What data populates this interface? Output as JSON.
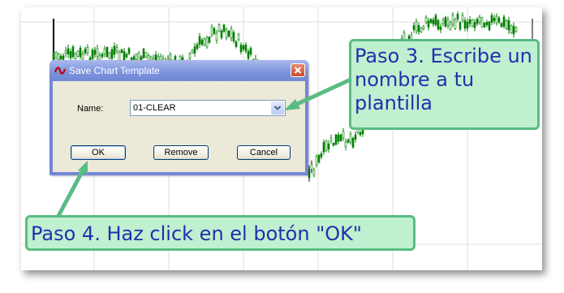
{
  "dialog": {
    "title": "Save Chart Template",
    "name_label": "Name:",
    "name_value": "01-CLEAR",
    "ok_label": "OK",
    "remove_label": "Remove",
    "cancel_label": "Cancel"
  },
  "callouts": {
    "step3": "Paso 3. Escribe un nombre a tu plantilla",
    "step4": "Paso 4. Haz click en el botón \"OK\""
  },
  "colors": {
    "callout_fill": "#bff0cf",
    "callout_border": "#5abc84",
    "callout_text": "#2230ad",
    "dialog_titlebar": "#7c92dc",
    "candle": "#008000"
  },
  "icons": {
    "app": "logo-icon",
    "close": "close-icon",
    "dropdown": "chevron-down-icon"
  }
}
